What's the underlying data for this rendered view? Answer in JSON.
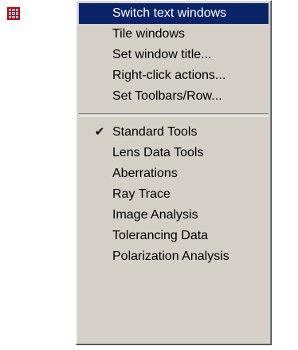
{
  "toolbar": {
    "icon": "window-grid-icon"
  },
  "menu": {
    "group1": [
      {
        "label": "Switch text windows",
        "selected": true
      },
      {
        "label": "Tile windows"
      },
      {
        "label": "Set window title..."
      },
      {
        "label": "Right-click actions..."
      },
      {
        "label": "Set Toolbars/Row..."
      }
    ],
    "group2": [
      {
        "label": "Standard Tools",
        "checked": true,
        "check_icon": "✔"
      },
      {
        "label": "Lens Data Tools"
      },
      {
        "label": "Aberrations"
      },
      {
        "label": "Ray Trace"
      },
      {
        "label": "Image Analysis"
      },
      {
        "label": "Tolerancing Data"
      },
      {
        "label": "Polarization Analysis"
      }
    ]
  },
  "colors": {
    "menu_bg": "#d4d0c8",
    "selection_bg": "#0a246a",
    "selection_text": "#ffffff"
  }
}
